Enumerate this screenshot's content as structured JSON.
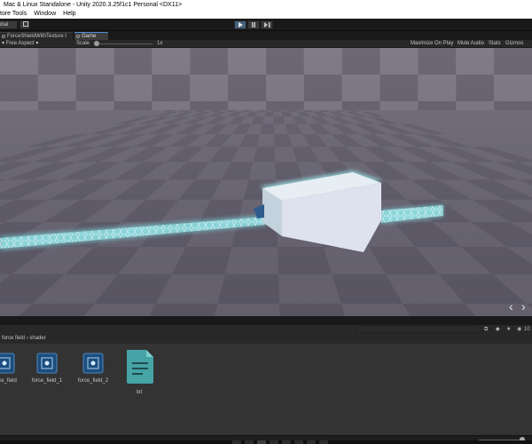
{
  "window": {
    "title": "Mac & Linux Standalone - Unity 2020.3.25f1c1 Personal <DX11>"
  },
  "menu": {
    "items": [
      "tore Tools",
      "Window",
      "Help"
    ]
  },
  "toolbar": {
    "account_label": "obal",
    "play_icon": "play-icon",
    "pause_icon": "pause-icon",
    "step_icon": "step-icon"
  },
  "tabs": [
    {
      "label": "ForceShieldWithTexture l"
    },
    {
      "label": "Game"
    }
  ],
  "game_header": {
    "aspect": "Free Aspect",
    "scale_label": "Scale",
    "scale_value": "1x",
    "maximize": "Maximize On Play",
    "mute": "Mute Audio",
    "stats": "Stats",
    "gizmos": "Gizmos"
  },
  "viewport": {
    "floor_color": "#6a6674",
    "tile_dark": "#5d5967",
    "tile_light": "#78747f",
    "wall_color": "#888492",
    "shield_color": "#8ff0f0",
    "cube_color": "#d6dbe8",
    "nav_prev": "‹",
    "nav_next": "›"
  },
  "project": {
    "breadcrumb": [
      "force field",
      "shader"
    ],
    "counter": "10",
    "assets": [
      {
        "name": "force_field",
        "icon": "shader-icon"
      },
      {
        "name": "force_field_1",
        "icon": "shader-icon"
      },
      {
        "name": "force_field_2",
        "icon": "shader-icon"
      },
      {
        "name": "txt",
        "icon": "text-file-icon"
      }
    ]
  }
}
